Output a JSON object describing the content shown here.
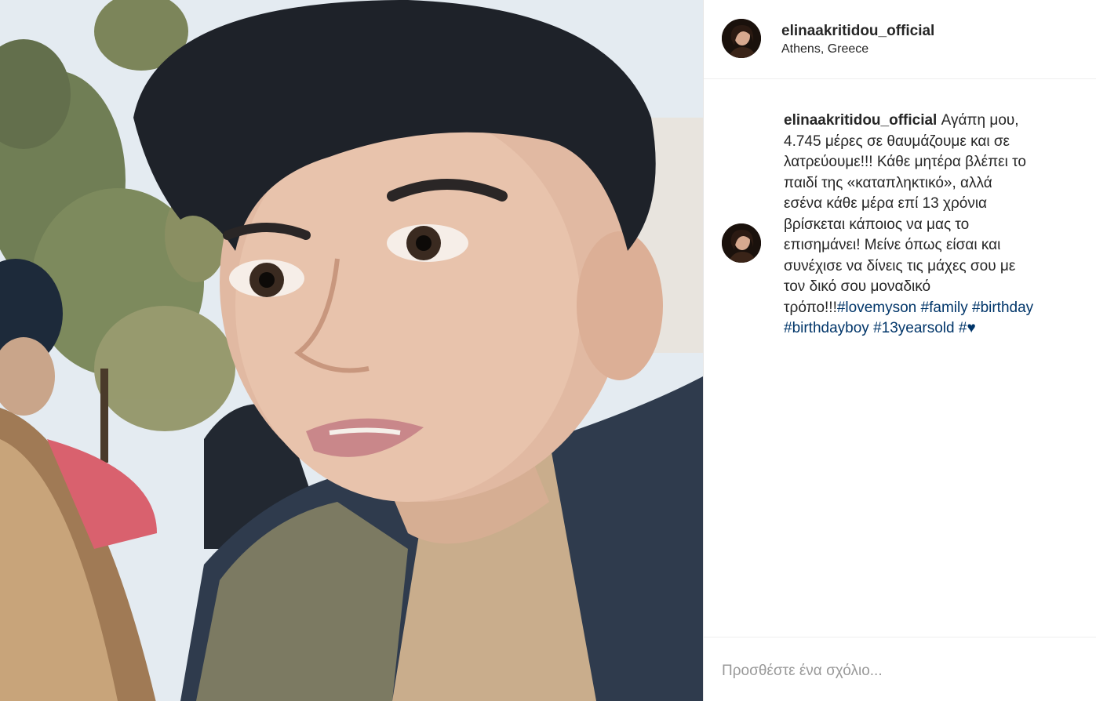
{
  "post": {
    "username": "elinaakritidou_official",
    "location": "Athens, Greece",
    "caption": {
      "lines": [
        "Αγάπη μου,",
        "4.745 μέρες σε θαυμάζουμε και σε",
        "λατρεύουμε!!! Κάθε μητέρα βλέπει το",
        "παιδί της «καταπληκτικό», αλλά",
        "εσένα κάθε μέρα επί 13 χρόνια",
        "βρίσκεται κάποιος να μας το",
        "επισημάνει! Μείνε όπως είσαι και",
        "συνέχισε να δίνεις τις μάχες σου με",
        "τον δικό σου μοναδικό",
        "τρόπο!!!"
      ],
      "hashtags": [
        "#lovemyson",
        "#family",
        "#birthday",
        "#birthdayboy",
        "#13yearsold",
        "#"
      ],
      "heart": "♥"
    },
    "comment": {
      "placeholder": "Προσθέστε ένα σχόλιο..."
    }
  },
  "icons": {
    "avatar": "profile-avatar"
  },
  "colors": {
    "text": "#262626",
    "hashtag": "#003569",
    "placeholder": "#999999",
    "border": "#efefef"
  }
}
